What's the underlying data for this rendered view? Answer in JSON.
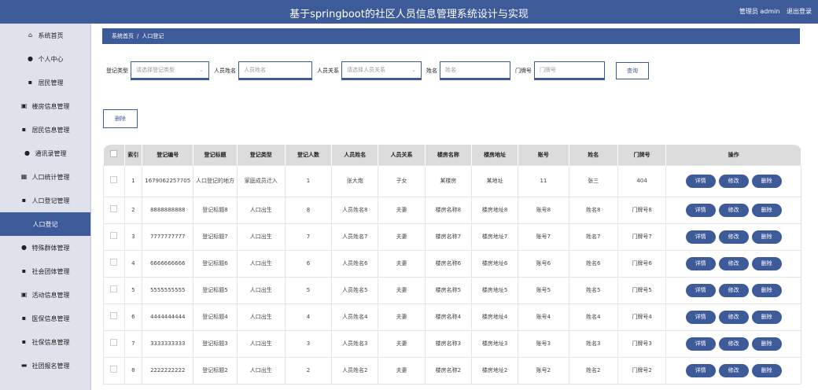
{
  "header": {
    "title": "基于springboot的社区人员信息管理系统设计与实现",
    "user_label": "管理员 admin",
    "logout_label": "退出登录"
  },
  "sidebar": {
    "items": [
      {
        "label": "系统首页",
        "icon": "home-icon",
        "active": false
      },
      {
        "label": "个人中心",
        "icon": "user-icon",
        "active": false
      },
      {
        "label": "居民管理",
        "icon": "grid-icon",
        "active": false
      },
      {
        "label": "楼房信息管理",
        "icon": "clipboard-icon",
        "active": false
      },
      {
        "label": "居民信息管理",
        "icon": "grid-icon",
        "active": false
      },
      {
        "label": "通讯录管理",
        "icon": "location-pin-icon",
        "active": false
      },
      {
        "label": "人口统计管理",
        "icon": "table-icon",
        "active": false
      },
      {
        "label": "人口登记管理",
        "icon": "grid-icon",
        "active": false
      },
      {
        "label": "人口登记",
        "icon": "",
        "active": true
      },
      {
        "label": "特殊群体管理",
        "icon": "user-icon",
        "active": false
      },
      {
        "label": "社会团体管理",
        "icon": "grid-icon",
        "active": false
      },
      {
        "label": "活动信息管理",
        "icon": "calendar-icon",
        "active": false
      },
      {
        "label": "医保信息管理",
        "icon": "grid-icon",
        "active": false
      },
      {
        "label": "社保信息管理",
        "icon": "grid-icon",
        "active": false
      },
      {
        "label": "社团报名管理",
        "icon": "message-icon",
        "active": false
      }
    ]
  },
  "breadcrumb": {
    "home": "系统首页",
    "separator": "/",
    "current": "人口登记"
  },
  "search": {
    "type_label": "登记类型",
    "type_placeholder": "请选择登记类型",
    "name_label": "人员姓名",
    "name_placeholder": "人员姓名",
    "relation_label": "人员关系",
    "relation_placeholder": "请选择人员关系",
    "xingming_label": "姓名",
    "xingming_placeholder": "姓名",
    "door_label": "门牌号",
    "door_placeholder": "门牌号",
    "query_label": "查询"
  },
  "toolbar": {
    "delete_label": "删除"
  },
  "table": {
    "headers": [
      "索引",
      "登记编号",
      "登记标题",
      "登记类型",
      "登记人数",
      "人员姓名",
      "人员关系",
      "楼房名称",
      "楼房地址",
      "账号",
      "姓名",
      "门牌号",
      "操作"
    ],
    "actions": {
      "detail": "详情",
      "edit": "修改",
      "delete": "删除"
    },
    "rows": [
      [
        "1",
        "1679062257705",
        "人口登记的地方",
        "家庭成员迁入",
        "1",
        "张大炮",
        "子女",
        "某楼房",
        "某地址",
        "11",
        "张三",
        "404"
      ],
      [
        "2",
        "8888888888",
        "登记标题8",
        "人口出生",
        "8",
        "人员姓名8",
        "夫妻",
        "楼房名称8",
        "楼房地址8",
        "账号8",
        "姓名8",
        "门牌号8"
      ],
      [
        "3",
        "7777777777",
        "登记标题7",
        "人口出生",
        "7",
        "人员姓名7",
        "夫妻",
        "楼房名称7",
        "楼房地址7",
        "账号7",
        "姓名7",
        "门牌号7"
      ],
      [
        "4",
        "6666666666",
        "登记标题6",
        "人口出生",
        "6",
        "人员姓名6",
        "夫妻",
        "楼房名称6",
        "楼房地址6",
        "账号6",
        "姓名6",
        "门牌号6"
      ],
      [
        "5",
        "5555555555",
        "登记标题5",
        "人口出生",
        "5",
        "人员姓名5",
        "夫妻",
        "楼房名称5",
        "楼房地址5",
        "账号5",
        "姓名5",
        "门牌号5"
      ],
      [
        "6",
        "4444444444",
        "登记标题4",
        "人口出生",
        "4",
        "人员姓名4",
        "夫妻",
        "楼房名称4",
        "楼房地址4",
        "账号4",
        "姓名4",
        "门牌号4"
      ],
      [
        "7",
        "3333333333",
        "登记标题3",
        "人口出生",
        "3",
        "人员姓名3",
        "夫妻",
        "楼房名称3",
        "楼房地址3",
        "账号3",
        "姓名3",
        "门牌号3"
      ],
      [
        "8",
        "2222222222",
        "登记标题2",
        "人口出生",
        "2",
        "人员姓名2",
        "夫妻",
        "楼房名称2",
        "楼房地址2",
        "账号2",
        "姓名2",
        "门牌号2"
      ]
    ]
  }
}
